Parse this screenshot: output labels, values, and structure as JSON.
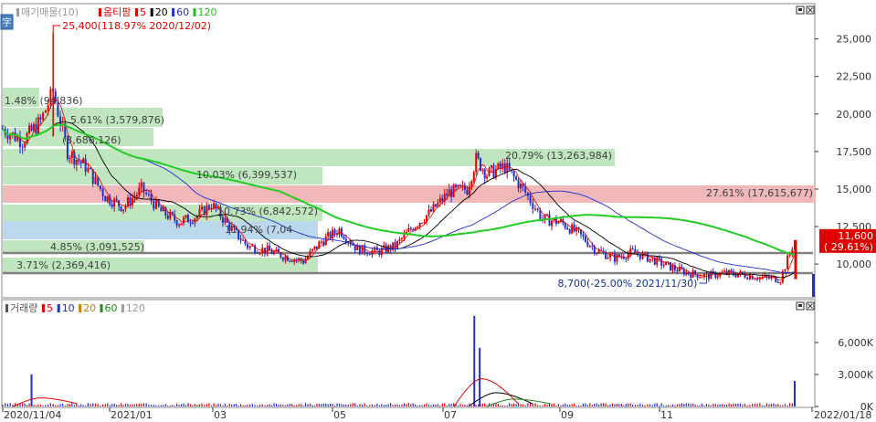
{
  "price_panel": {
    "legend": [
      {
        "label": "매기매물(10)",
        "color": "#9a9a9a"
      },
      {
        "label": "옴티팜",
        "color": "#e00000"
      },
      {
        "label": "5",
        "color": "#e00000"
      },
      {
        "label": "20",
        "color": "#000000"
      },
      {
        "label": "60",
        "color": "#1f2fd0"
      },
      {
        "label": "120",
        "color": "#22bb22"
      }
    ],
    "y_ticks": [
      "25,000",
      "22,500",
      "20,000",
      "17,500",
      "15,000",
      "12,500",
      "10,000"
    ],
    "current_price": "11,600",
    "current_change": "( 29.61%)",
    "high_label": "25,400(118.97% 2020/12/02)",
    "low_label": "8,700(-25.00% 2021/11/30)",
    "volume_profile_labels": [
      "1.48% (94,836)",
      "5.61% (3,579,876)",
      "(3,686,126)",
      "20.79% (13,263,984)",
      "10.03% (6,399,537)",
      "27.61% (17,615,677)",
      "10.73% (6,842,572)",
      "11.94% (7,04",
      "4.85% (3,091,525)",
      "3.71% (2,369,416)"
    ]
  },
  "volume_panel": {
    "legend": [
      {
        "label": "거래량",
        "color": "#555555"
      },
      {
        "label": "5",
        "color": "#e00000"
      },
      {
        "label": "10",
        "color": "#1f2fd0"
      },
      {
        "label": "20",
        "color": "#d08000"
      },
      {
        "label": "60",
        "color": "#228822"
      },
      {
        "label": "120",
        "color": "#9a9a9a"
      }
    ],
    "y_ticks": [
      "6,000K",
      "3,000K",
      "0K"
    ]
  },
  "x_axis_labels": [
    "2020/11/04",
    "2021/01",
    "03",
    "05",
    "07",
    "09",
    "11",
    "2022/01/18"
  ],
  "colors": {
    "up": "#e00000",
    "down": "#1f2fd0",
    "ma5": "#e00000",
    "ma20": "#000000",
    "ma60": "#1f2fd0",
    "ma120": "#22cc22",
    "band_green": "#bfe6bf",
    "band_red": "#f0b8b8",
    "band_blue": "#bcd8ec",
    "hline": "#808080"
  },
  "chart_data": [
    {
      "type": "candlestick",
      "title": "옴티팜",
      "x_range": [
        "2020/11/04",
        "2022/01/18"
      ],
      "ylim": [
        8000,
        26500
      ],
      "close_series": [
        [
          "2020/11/04",
          19000
        ],
        [
          "2020/11/15",
          18200
        ],
        [
          "2020/11/25",
          19500
        ],
        [
          "2020/12/02",
          21500
        ],
        [
          "2020/12/10",
          17500
        ],
        [
          "2020/12/20",
          16500
        ],
        [
          "2020/12/31",
          14500
        ],
        [
          "2021/01/10",
          13800
        ],
        [
          "2021/01/20",
          15000
        ],
        [
          "2021/01/31",
          13500
        ],
        [
          "2021/02/10",
          12800
        ],
        [
          "2021/02/20",
          13200
        ],
        [
          "2021/02/28",
          14000
        ],
        [
          "2021/03/10",
          12500
        ],
        [
          "2021/03/20",
          11200
        ],
        [
          "2021/03/31",
          10900
        ],
        [
          "2021/04/10",
          10500
        ],
        [
          "2021/04/20",
          10200
        ],
        [
          "2021/04/30",
          11500
        ],
        [
          "2021/05/10",
          12300
        ],
        [
          "2021/05/20",
          11000
        ],
        [
          "2021/05/31",
          10800
        ],
        [
          "2021/06/10",
          11200
        ],
        [
          "2021/06/20",
          12500
        ],
        [
          "2021/06/30",
          13500
        ],
        [
          "2021/07/10",
          14800
        ],
        [
          "2021/07/20",
          15000
        ],
        [
          "2021/07/25",
          17000
        ],
        [
          "2021/07/31",
          16000
        ],
        [
          "2021/08/10",
          16500
        ],
        [
          "2021/08/20",
          15000
        ],
        [
          "2021/08/31",
          13000
        ],
        [
          "2021/09/10",
          12800
        ],
        [
          "2021/09/20",
          12000
        ],
        [
          "2021/09/30",
          10900
        ],
        [
          "2021/10/10",
          10400
        ],
        [
          "2021/10/20",
          10800
        ],
        [
          "2021/10/31",
          10300
        ],
        [
          "2021/11/10",
          9800
        ],
        [
          "2021/11/20",
          9400
        ],
        [
          "2021/11/30",
          9200
        ],
        [
          "2021/12/10",
          9400
        ],
        [
          "2021/12/20",
          9300
        ],
        [
          "2021/12/31",
          9100
        ],
        [
          "2022/01/10",
          9000
        ],
        [
          "2022/01/18",
          11600
        ]
      ],
      "high": {
        "value": 25400,
        "change_pct": 118.97,
        "date": "2020/12/02"
      },
      "low": {
        "value": 8700,
        "change_pct": -25.0,
        "date": "2021/11/30"
      },
      "last": {
        "value": 11600,
        "change_pct": 29.61
      },
      "volume_profile": [
        {
          "pct": 1.48,
          "volume": 94836
        },
        {
          "pct": 5.61,
          "volume": 3579876
        },
        {
          "volume": 3686126
        },
        {
          "pct": 20.79,
          "volume": 13263984
        },
        {
          "pct": 10.03,
          "volume": 6399537
        },
        {
          "pct": 27.61,
          "volume": 17615677
        },
        {
          "pct": 10.73,
          "volume": 6842572
        },
        {
          "pct": 11.94
        },
        {
          "pct": 4.85,
          "volume": 3091525
        },
        {
          "pct": 3.71,
          "volume": 2369416
        }
      ],
      "moving_averages": [
        "5",
        "20",
        "60",
        "120"
      ]
    },
    {
      "type": "bar",
      "title": "거래량",
      "ylim": [
        0,
        9000000
      ],
      "spikes": [
        [
          "2020/11/20",
          3000000
        ],
        [
          "2021/07/24",
          8500000
        ],
        [
          "2021/07/27",
          5500000
        ],
        [
          "2022/01/18",
          2400000
        ]
      ]
    }
  ]
}
